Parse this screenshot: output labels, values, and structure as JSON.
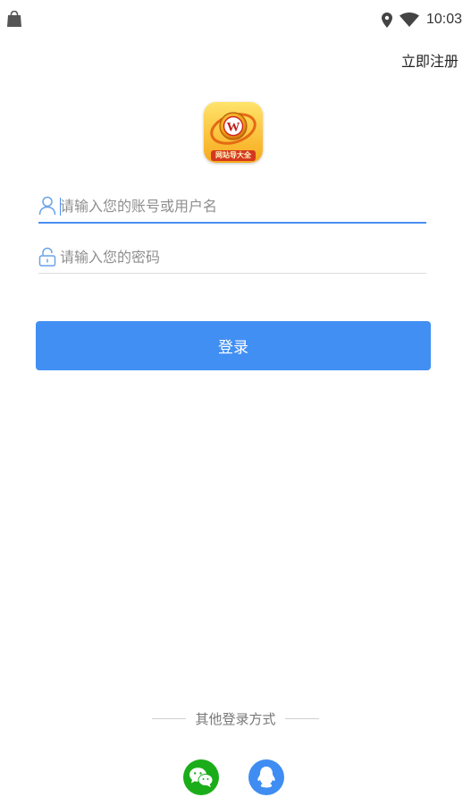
{
  "status_bar": {
    "time": "10:03",
    "icons": [
      "shopping-bag-icon",
      "location-pin-icon",
      "wifi-icon"
    ]
  },
  "header": {
    "register_label": "立即注册"
  },
  "logo": {
    "letter": "W",
    "tag_text": "网站导大全"
  },
  "form": {
    "username": {
      "value": "",
      "placeholder": "请输入您的账号或用户名",
      "icon": "user-icon"
    },
    "password": {
      "value": "",
      "placeholder": "请输入您的密码",
      "icon": "lock-icon"
    },
    "login_label": "登录"
  },
  "other_login": {
    "label": "其他登录方式",
    "providers": [
      {
        "name": "wechat",
        "icon": "wechat-icon",
        "color": "#1aad19"
      },
      {
        "name": "qq",
        "icon": "qq-icon",
        "color": "#3f8df2"
      }
    ]
  },
  "colors": {
    "accent": "#418ff3",
    "input_underline_active": "#4a8ff0",
    "input_underline": "#dcdcdc"
  }
}
